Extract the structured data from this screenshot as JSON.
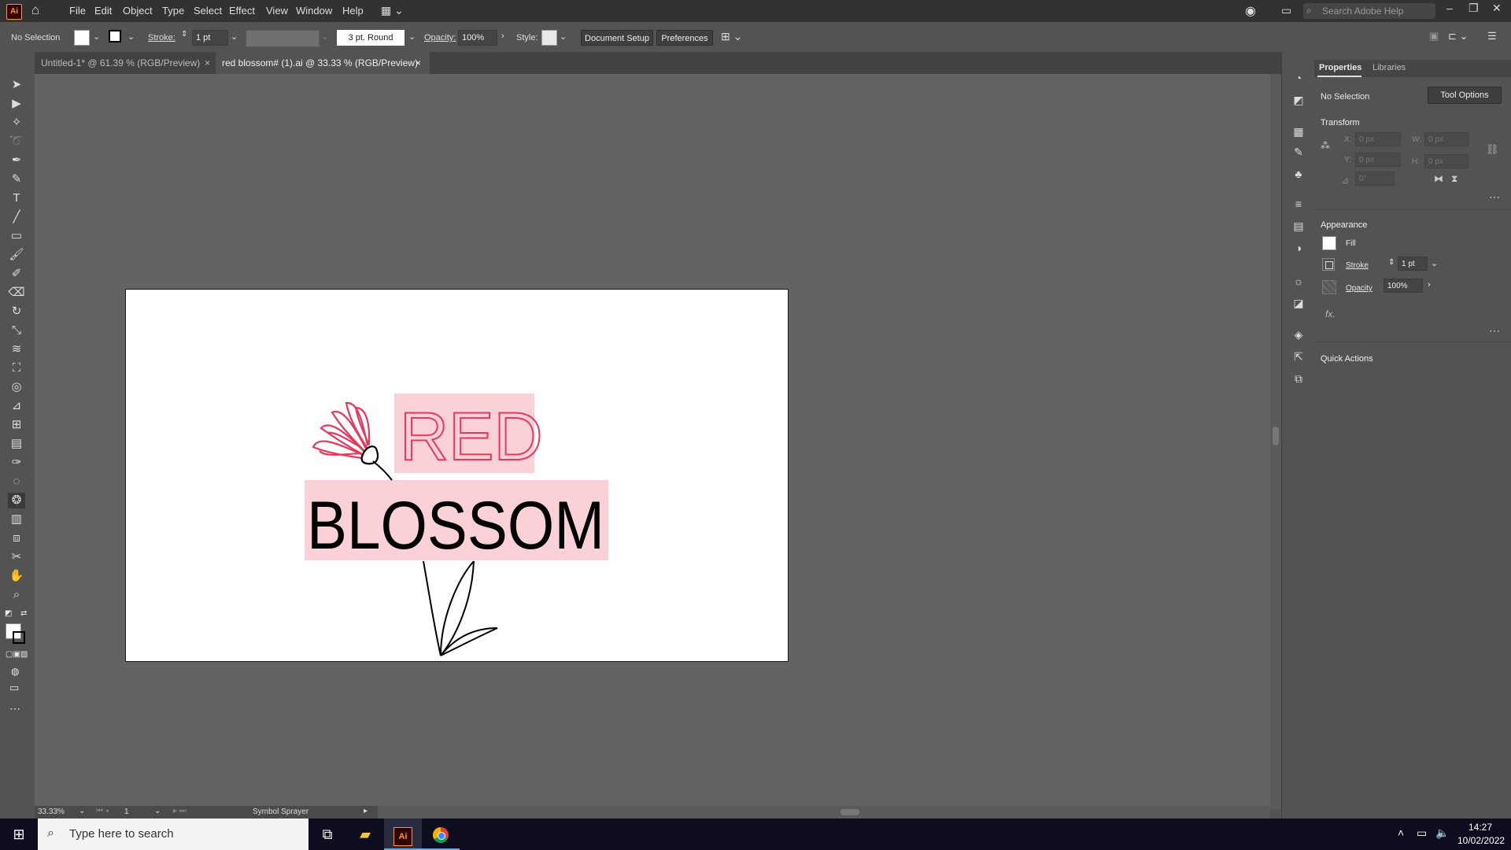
{
  "app": {
    "logo": "Ai",
    "menu": [
      "File",
      "Edit",
      "Object",
      "Type",
      "Select",
      "Effect",
      "View",
      "Window",
      "Help"
    ],
    "search_placeholder": "Search Adobe Help"
  },
  "control_bar": {
    "selection": "No Selection",
    "stroke_label": "Stroke:",
    "stroke_value": "1 pt",
    "brush": "3 pt. Round",
    "opacity_label": "Opacity:",
    "opacity_value": "100%",
    "style_label": "Style:",
    "document_setup": "Document Setup",
    "preferences": "Preferences"
  },
  "tabs": [
    {
      "label": "Untitled-1* @ 61.39 % (RGB/Preview)",
      "close": "×"
    },
    {
      "label": "red blossom# (1).ai @ 33.33 % (RGB/Preview)",
      "close": "×"
    }
  ],
  "artwork": {
    "title_top": "RED",
    "title_bottom": "BLOSSOM",
    "highlight_color": "#f9d1d6",
    "flower_color": "#e8375a"
  },
  "status_bar": {
    "zoom": "33.33%",
    "page": "1",
    "tool": "Symbol Sprayer"
  },
  "panel": {
    "tabs": [
      "Properties",
      "Libraries"
    ],
    "selection": "No Selection",
    "tool_options": "Tool Options",
    "transform_title": "Transform",
    "x_label": "X:",
    "x_value": "0 px",
    "y_label": "Y:",
    "y_value": "0 px",
    "w_label": "W:",
    "w_value": "0 px",
    "h_label": "H:",
    "h_value": "0 px",
    "angle_value": "0°",
    "appearance_title": "Appearance",
    "fill_label": "Fill",
    "stroke_label": "Stroke",
    "stroke_value": "1 pt",
    "opacity_label": "Opacity",
    "opacity_value": "100%",
    "fx_label": "fx.",
    "quick_actions_title": "Quick Actions"
  },
  "taskbar": {
    "search_placeholder": "Type here to search",
    "time": "14:27",
    "date": "10/02/2022"
  }
}
